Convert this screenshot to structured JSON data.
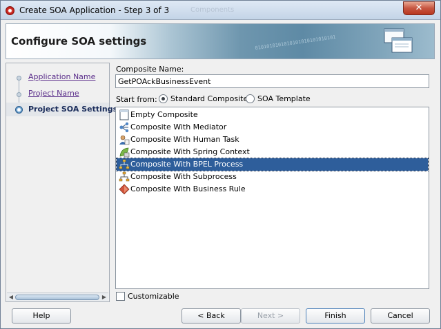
{
  "window": {
    "title": "Create SOA Application - Step 3 of 3",
    "ghost_title": "Components"
  },
  "banner": {
    "title": "Configure SOA settings",
    "binary": "0101010101010101010101010101"
  },
  "steps": [
    {
      "label": "Application Name",
      "state": "done"
    },
    {
      "label": "Project Name",
      "state": "done"
    },
    {
      "label": "Project SOA Settings",
      "state": "active"
    }
  ],
  "form": {
    "composite_name_label": "Composite Name:",
    "composite_name_value": "GetPOAckBusinessEvent",
    "start_from_label": "Start from:",
    "radio_standard": "Standard Composite",
    "radio_template": "SOA Template",
    "selected_radio": "Standard Composite",
    "customizable_label": "Customizable",
    "customizable_checked": false
  },
  "templates": [
    {
      "label": "Empty Composite",
      "icon": "empty-composite-icon"
    },
    {
      "label": "Composite With Mediator",
      "icon": "mediator-icon"
    },
    {
      "label": "Composite With Human Task",
      "icon": "human-task-icon"
    },
    {
      "label": "Composite With Spring Context",
      "icon": "spring-context-icon"
    },
    {
      "label": "Composite With BPEL Process",
      "icon": "bpel-process-icon",
      "selected": true
    },
    {
      "label": "Composite With Subprocess",
      "icon": "subprocess-icon"
    },
    {
      "label": "Composite With Business Rule",
      "icon": "business-rule-icon"
    }
  ],
  "buttons": {
    "help": "Help",
    "back": "< Back",
    "next": "Next >",
    "finish": "Finish",
    "cancel": "Cancel"
  },
  "colors": {
    "selection": "#2e5e9b",
    "link": "#5a2d8a",
    "active_step": "#1b2d5b"
  }
}
